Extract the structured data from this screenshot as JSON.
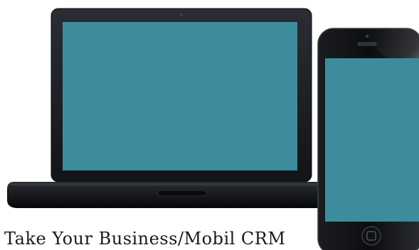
{
  "caption": "Take Your Business/Mobil CRM",
  "colors": {
    "screen": "#3d8c9e",
    "device_body": "#111316",
    "bezel": "#1b1e23",
    "background": "#ffffff"
  },
  "devices": {
    "laptop": {
      "type": "laptop"
    },
    "phone": {
      "type": "smartphone"
    }
  }
}
